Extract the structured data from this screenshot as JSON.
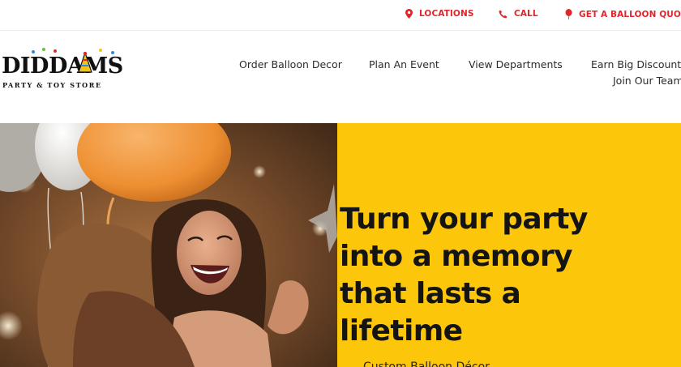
{
  "topbar": {
    "links": [
      {
        "label": "LOCATIONS",
        "icon": "map-pin-icon"
      },
      {
        "label": "CALL",
        "icon": "phone-icon"
      },
      {
        "label": "GET A BALLOON QUOTE",
        "icon": "balloon-icon"
      }
    ],
    "accent_color": "#e0262b"
  },
  "logo": {
    "main": "DIDDAMS",
    "sub": "PARTY & TOY STORE"
  },
  "nav": {
    "items": [
      "Order Balloon Decor",
      "Plan An Event",
      "View Departments",
      "Earn Big Discounts",
      "Join Our Team"
    ]
  },
  "hero": {
    "title": "Turn your party into a memory that lasts a lifetime",
    "subtitle": "Custom Balloon Décor",
    "panel_color": "#fcc70b"
  }
}
